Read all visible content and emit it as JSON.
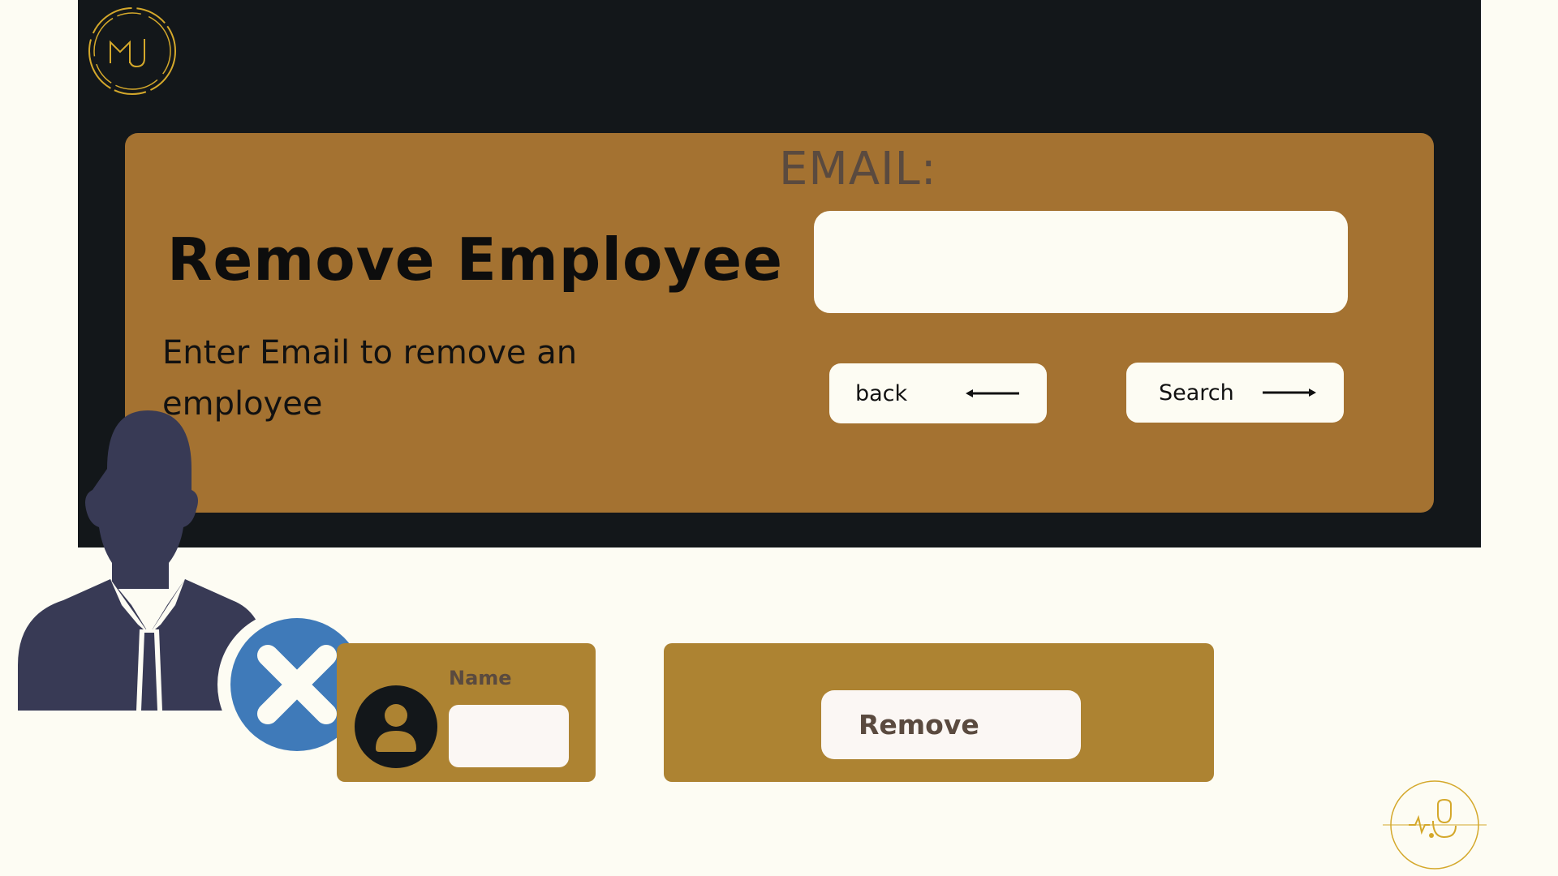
{
  "header": {
    "logo_icon": "mj-monogram-logo"
  },
  "main": {
    "title": "Remove Employee",
    "subtitle": "Enter Email to remove an employee",
    "email_label": "EMAIL:",
    "email_value": "",
    "back_label": "back",
    "back_icon": "arrow-left-icon",
    "search_label": "Search",
    "search_icon": "arrow-right-icon"
  },
  "illustration": {
    "icon": "employee-silhouette-icon",
    "badge_icon": "close-x-icon"
  },
  "result": {
    "name_label": "Name",
    "name_value": "",
    "avatar_icon": "user-avatar-icon",
    "remove_label": "Remove"
  },
  "footer": {
    "logo_icon": "medical-heartbeat-logo"
  },
  "colors": {
    "background": "#fdfcf3",
    "dark_panel": "#13171a",
    "card_brown": "#a47231",
    "card_gold": "#ad8332",
    "badge_blue": "#3f7ab9",
    "silhouette": "#383a55",
    "logo_gold": "#d4a82b"
  }
}
